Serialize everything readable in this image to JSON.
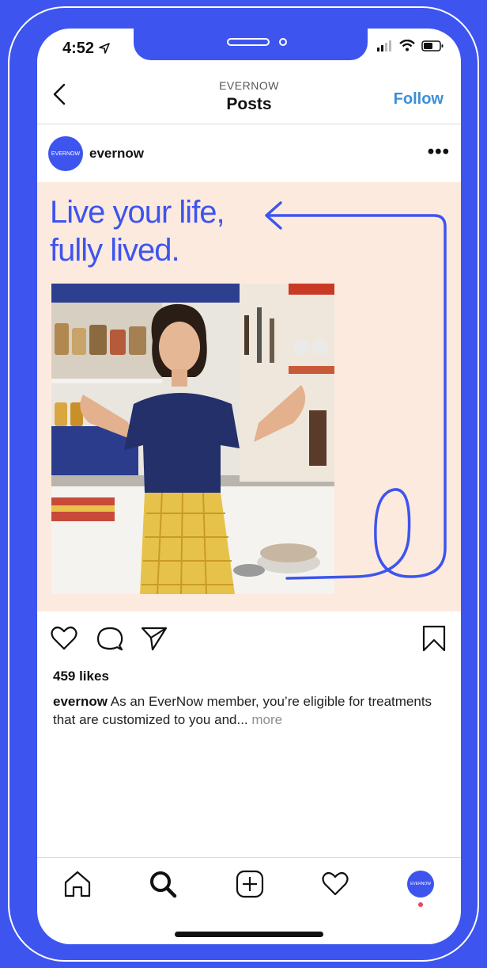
{
  "status_bar": {
    "time": "4:52"
  },
  "nav": {
    "subtitle": "EVERNOW",
    "title": "Posts",
    "follow_label": "Follow"
  },
  "post": {
    "avatar_text": "EVERNOW",
    "username": "evernow",
    "headline": "Live your life,\nfully lived.",
    "likes": "459 likes",
    "caption_user": "evernow",
    "caption_text": " As an EverNow member, you’re eligible for treatments that are customized to you and... ",
    "caption_more": "more"
  },
  "tabbar": {
    "profile_text": "EVERNOW"
  },
  "colors": {
    "brand_blue": "#3d55ee",
    "follow_blue": "#3d8fd8",
    "post_bg": "#fdeade"
  },
  "icons": [
    "back-chevron-icon",
    "more-options-icon",
    "heart-icon",
    "comment-icon",
    "share-icon",
    "bookmark-icon",
    "home-icon",
    "search-icon",
    "add-post-icon",
    "activity-heart-icon"
  ]
}
